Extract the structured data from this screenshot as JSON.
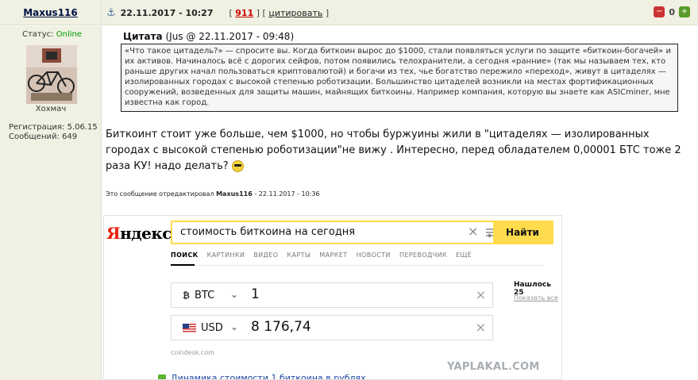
{
  "post": {
    "username": "Maxus116",
    "date": "22.11.2017 - 10:27",
    "post_number": "911",
    "cite_label": "цитировать",
    "rating": "0"
  },
  "user": {
    "status_label": "Статус:",
    "status_value": "Online",
    "title": "Хохмач",
    "reg_label": "Регистрация: 5.06.15",
    "messages_label": "Сообщений: 649"
  },
  "quote": {
    "title_bold": "Цитата",
    "title_rest": "(Jus @ 22.11.2017 - 09:48)",
    "text": "«Что такое цитадель?» — спросите вы. Когда биткоин вырос до $1000, стали появляться услуги по защите «биткоин-богачей» и их активов. Начиналось всё с дорогих сейфов, потом появились телохранители, а сегодня «ранние» (так мы называем тех, кто раньше других начал пользоваться криптовалютой) и богачи из тех, чье богатство пережило «переход», живут в цитаделях — изолированных городах с высокой степенью роботизации. Большинство цитаделей возникли на местах фортификационных сооружений, возведенных для защиты машин, майнящих биткоины. Например компания, которую вы знаете как ASICminer, мне известна как город."
  },
  "body": {
    "text": "Биткоинт стоит уже больше, чем $1000, но чтобы буржуины жили в \"цитаделях — изолированных городах с высокой степенью роботизации\"не вижу . Интересно, перед обладателем 0,00001 БТС тоже 2 раза КУ! надо делать?"
  },
  "edited": {
    "prefix": "Это сообщение отредактировал",
    "author": "Maxus116",
    "suffix": "- 22.11.2017 - 10:36"
  },
  "yandex": {
    "logo_red": "Я",
    "logo_rest": "ндекс",
    "query": "стоимость биткоина на сегодня",
    "search_button": "Найти",
    "tabs": [
      "ПОИСК",
      "КАРТИНКИ",
      "ВИДЕО",
      "КАРТЫ",
      "МАРКЕТ",
      "НОВОСТИ",
      "ПЕРЕВОДЧИК",
      "ЕЩЁ"
    ],
    "from_currency": "BTC",
    "from_amount": "1",
    "to_currency": "USD",
    "to_amount": "8 176,74",
    "source": "coindesk.com",
    "found": "Нашлось 25",
    "show_all": "Показать все",
    "bottom_link": "Динамика стоимости 1 биткоина в рублях"
  },
  "watermark": "YAPLAKAL.COM"
}
